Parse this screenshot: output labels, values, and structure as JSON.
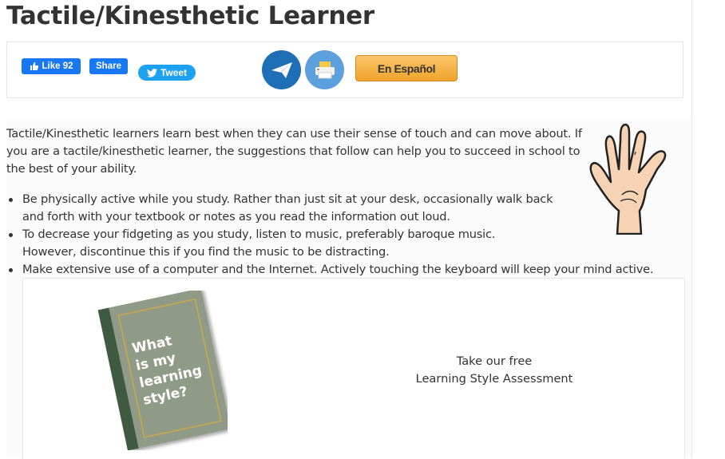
{
  "page": {
    "title": "Tactile/Kinesthetic Learner"
  },
  "share": {
    "fb_like_label": "Like 92",
    "fb_share_label": "Share",
    "tweet_label": "Tweet",
    "espanol_label": "En Español"
  },
  "intro": "Tactile/Kinesthetic learners learn best when they can use their sense of touch and can move about. If you are a tactile/kinesthetic learner, the suggestions that follow can help you to succeed in school to the best of your ability.",
  "tips": [
    "Be physically active while you study. Rather than just sit at your desk, occasionally walk back and forth with your textbook or notes as you read the information out loud.",
    "To decrease your fidgeting as you study, listen to music, preferably baroque music. However, discontinue this if you find the music to be distracting.",
    "Make extensive use of a computer and the Internet. Actively touching the keyboard will keep your mind active."
  ],
  "promo": {
    "book_lines": [
      "What",
      "is my",
      "learning",
      "style?"
    ],
    "line1": "Take our free",
    "line2": "Learning Style Assessment"
  }
}
